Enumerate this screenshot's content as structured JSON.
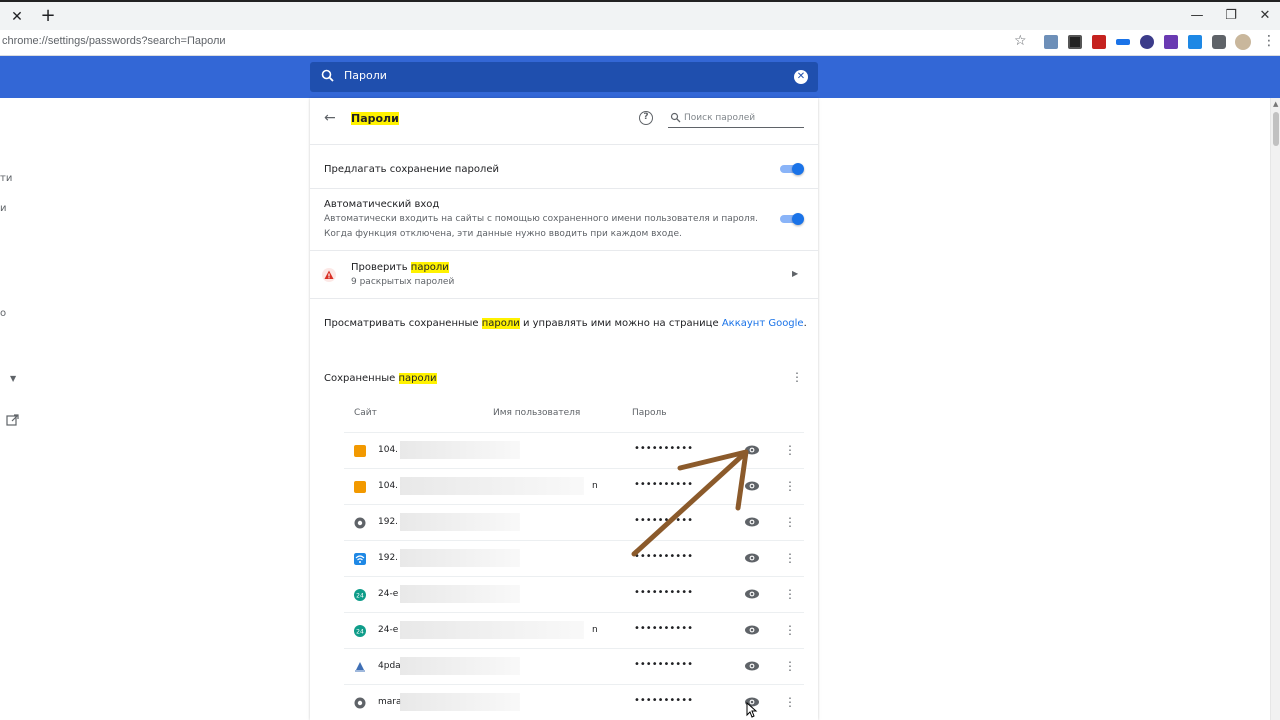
{
  "browser": {
    "url": "chrome://settings/passwords?search=Пароли",
    "tab_close_glyph": "✕",
    "new_tab_glyph": "+",
    "window_controls": [
      "—",
      "❐",
      "✕"
    ]
  },
  "search": {
    "query": "Пароли",
    "clear_glyph": "✕"
  },
  "left_nav_fragments": [
    "ти",
    "и",
    "о"
  ],
  "page": {
    "title": "Пароли",
    "search_placeholder": "Поиск паролей",
    "offer_to_save": {
      "label": "Предлагать сохранение паролей",
      "enabled": true
    },
    "auto_signin": {
      "label": "Автоматический вход",
      "desc_line1": "Автоматически входить на сайты с помощью сохраненного имени пользователя и пароля.",
      "desc_line2": "Когда функция отключена, эти данные нужно вводить при каждом входе.",
      "enabled": true
    },
    "check": {
      "label_prefix": "Проверить ",
      "label_highlight": "пароли",
      "sub": "9 раскрытых паролей"
    },
    "google_account": {
      "text_prefix": "Просматривать сохраненные ",
      "text_highlight": "пароли",
      "text_suffix": " и управлять ими можно на странице ",
      "link": "Аккаунт Google",
      "end": "."
    },
    "saved": {
      "title_prefix": "Сохраненные ",
      "title_highlight": "пароли",
      "columns": [
        "Сайт",
        "Имя пользователя",
        "Пароль"
      ],
      "rows": [
        {
          "site": "104.",
          "user": "",
          "password": "••••••••••",
          "favicon": "orange"
        },
        {
          "site": "104.",
          "user": "n",
          "password": "••••••••••",
          "favicon": "orange"
        },
        {
          "site": "192.",
          "user": "",
          "password": "••••••••••",
          "favicon": "globe"
        },
        {
          "site": "192.",
          "user": "",
          "password": "••••••••••",
          "favicon": "wifi"
        },
        {
          "site": "24-e",
          "user": "",
          "password": "••••••••••",
          "favicon": "teal"
        },
        {
          "site": "24-e",
          "user": "n",
          "password": "••••••••••",
          "favicon": "teal"
        },
        {
          "site": "4pda",
          "user": "",
          "password": "••••••••••",
          "favicon": "blue"
        },
        {
          "site": "mara",
          "user": "",
          "password": "••••••••••",
          "favicon": "globe"
        }
      ]
    }
  },
  "colors": {
    "accent": "#3367d6",
    "toggle_on": "#1a73e8",
    "highlight": "#fff200",
    "annotation_arrow": "#8b5a2b"
  }
}
